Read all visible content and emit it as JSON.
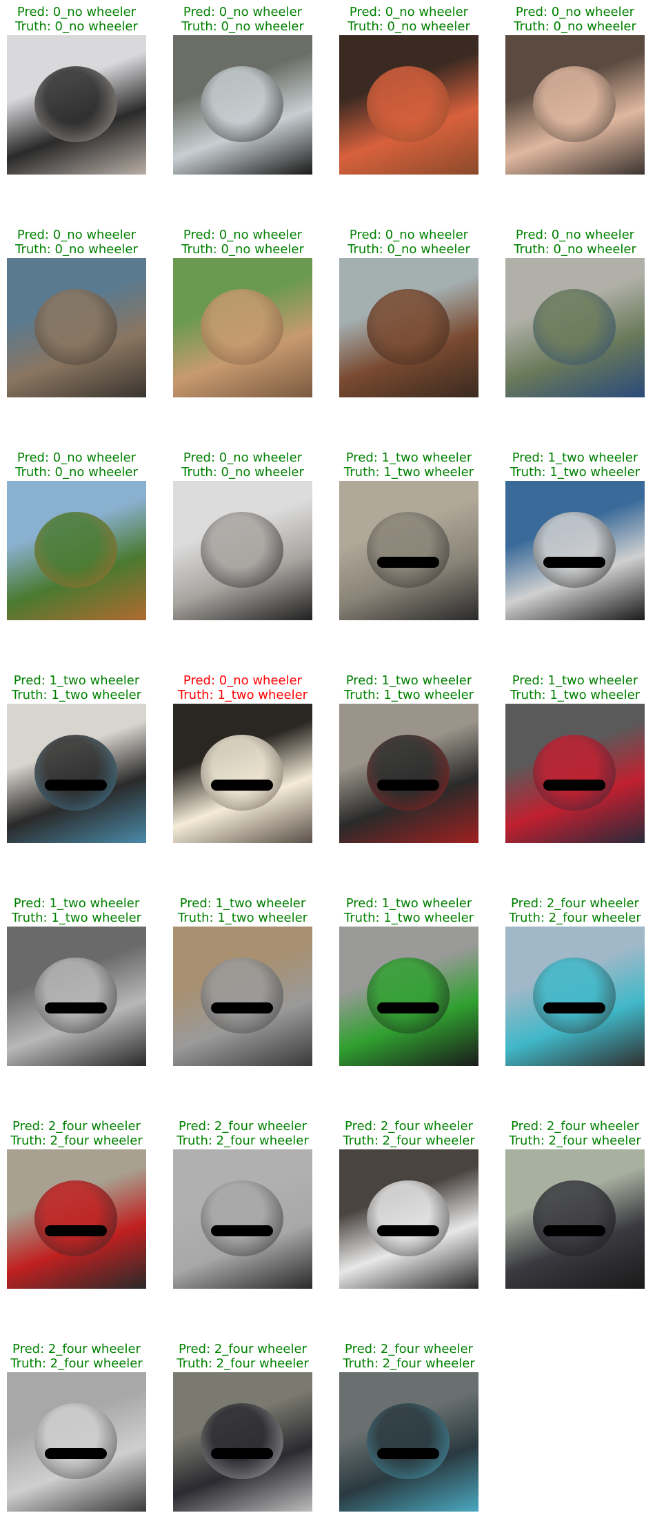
{
  "colors": {
    "correct": "#008000",
    "incorrect": "#ff0000"
  },
  "pred_prefix": "Pred: ",
  "truth_prefix": "Truth: ",
  "samples": [
    {
      "pred": "0_no wheeler",
      "truth": "0_no wheeler",
      "correct": true,
      "image": "cat-in-sink",
      "palette": [
        "#d9d9dc",
        "#2a2a2a",
        "#b8aea6"
      ]
    },
    {
      "pred": "0_no wheeler",
      "truth": "0_no wheeler",
      "correct": true,
      "image": "glass-bottle",
      "palette": [
        "#6a6e66",
        "#c8cfd2",
        "#1a1a1a"
      ]
    },
    {
      "pred": "0_no wheeler",
      "truth": "0_no wheeler",
      "correct": true,
      "image": "orange-armchair",
      "palette": [
        "#3b2a22",
        "#d8613d",
        "#8b4a2a"
      ]
    },
    {
      "pred": "0_no wheeler",
      "truth": "0_no wheeler",
      "correct": true,
      "image": "baby-with-party-hat",
      "palette": [
        "#5a4a40",
        "#e0b8a0",
        "#3c3430"
      ]
    },
    {
      "pred": "0_no wheeler",
      "truth": "0_no wheeler",
      "correct": true,
      "image": "monkey-thinking",
      "palette": [
        "#5a7a90",
        "#8a7560",
        "#3a3530"
      ]
    },
    {
      "pred": "0_no wheeler",
      "truth": "0_no wheeler",
      "correct": true,
      "image": "cartoon-monkey",
      "palette": [
        "#6a9a50",
        "#c89a70",
        "#7a5a40"
      ]
    },
    {
      "pred": "0_no wheeler",
      "truth": "0_no wheeler",
      "correct": true,
      "image": "caveman-figure",
      "palette": [
        "#a4afb0",
        "#7a4a30",
        "#3a2a20"
      ]
    },
    {
      "pred": "0_no wheeler",
      "truth": "0_no wheeler",
      "correct": true,
      "image": "boy-in-striped-shirt",
      "palette": [
        "#b0b0a8",
        "#6a7a5a",
        "#2a4a7a"
      ]
    },
    {
      "pred": "0_no wheeler",
      "truth": "0_no wheeler",
      "correct": true,
      "image": "cow-in-field",
      "palette": [
        "#8ab0d0",
        "#4a7a30",
        "#b06a30"
      ]
    },
    {
      "pred": "0_no wheeler",
      "truth": "0_no wheeler",
      "correct": true,
      "image": "hamster-face",
      "palette": [
        "#dcdcdc",
        "#a8a4a0",
        "#202020"
      ]
    },
    {
      "pred": "1_two wheeler",
      "truth": "1_two wheeler",
      "correct": true,
      "image": "motorcycle-on-road",
      "palette": [
        "#b0a898",
        "#8a8478",
        "#2a2a2a"
      ]
    },
    {
      "pred": "1_two wheeler",
      "truth": "1_two wheeler",
      "correct": true,
      "image": "motorcycle-front",
      "palette": [
        "#3a6a9a",
        "#d0d0d0",
        "#1a1a1a"
      ]
    },
    {
      "pred": "1_two wheeler",
      "truth": "1_two wheeler",
      "correct": true,
      "image": "electric-scooter",
      "palette": [
        "#d8d4ce",
        "#2a2a2a",
        "#4a8aa8"
      ]
    },
    {
      "pred": "0_no wheeler",
      "truth": "1_two wheeler",
      "correct": false,
      "image": "scooter-headlight",
      "palette": [
        "#2a2622",
        "#f4ecd8",
        "#5a5048"
      ]
    },
    {
      "pred": "1_two wheeler",
      "truth": "1_two wheeler",
      "correct": true,
      "image": "motorcycle-closeup",
      "palette": [
        "#9a948a",
        "#2a2a2a",
        "#a02020"
      ]
    },
    {
      "pred": "1_two wheeler",
      "truth": "1_two wheeler",
      "correct": true,
      "image": "red-scooter-people",
      "palette": [
        "#5a5a5a",
        "#c02030",
        "#2a2a3a"
      ]
    },
    {
      "pred": "1_two wheeler",
      "truth": "1_two wheeler",
      "correct": true,
      "image": "grey-scooter",
      "palette": [
        "#6a6a6a",
        "#b8b8b8",
        "#2a2a2a"
      ]
    },
    {
      "pred": "1_two wheeler",
      "truth": "1_two wheeler",
      "correct": true,
      "image": "silver-scooter",
      "palette": [
        "#a89070",
        "#9a9a9a",
        "#3a3a3a"
      ]
    },
    {
      "pred": "1_two wheeler",
      "truth": "1_two wheeler",
      "correct": true,
      "image": "green-sport-bike",
      "palette": [
        "#9a9a98",
        "#30a030",
        "#1a1a1a"
      ]
    },
    {
      "pred": "2_four wheeler",
      "truth": "2_four wheeler",
      "correct": true,
      "image": "blue-van",
      "palette": [
        "#a0b8c8",
        "#40b8c8",
        "#303030"
      ]
    },
    {
      "pred": "2_four wheeler",
      "truth": "2_four wheeler",
      "correct": true,
      "image": "red-suv",
      "palette": [
        "#a8a090",
        "#c02020",
        "#2a2a2a"
      ]
    },
    {
      "pred": "2_four wheeler",
      "truth": "2_four wheeler",
      "correct": true,
      "image": "silver-hatchback",
      "palette": [
        "#b0b0b0",
        "#a8a8a8",
        "#2a2a2a"
      ]
    },
    {
      "pred": "2_four wheeler",
      "truth": "2_four wheeler",
      "correct": true,
      "image": "white-suv",
      "palette": [
        "#4a4440",
        "#e8e8e8",
        "#2a2a2a"
      ]
    },
    {
      "pred": "2_four wheeler",
      "truth": "2_four wheeler",
      "correct": true,
      "image": "dark-grey-hatchback",
      "palette": [
        "#a8b0a0",
        "#3a3a40",
        "#1a1a1a"
      ]
    },
    {
      "pred": "2_four wheeler",
      "truth": "2_four wheeler",
      "correct": true,
      "image": "silver-car-front",
      "palette": [
        "#a8a8a8",
        "#cfcfcf",
        "#3a3a3a"
      ]
    },
    {
      "pred": "2_four wheeler",
      "truth": "2_four wheeler",
      "correct": true,
      "image": "black-compact-suv",
      "palette": [
        "#7a7a70",
        "#2a2a30",
        "#bcbcbc"
      ]
    },
    {
      "pred": "2_four wheeler",
      "truth": "2_four wheeler",
      "correct": true,
      "image": "blue-suv-front",
      "palette": [
        "#6a7070",
        "#2a3a40",
        "#4aa8c0"
      ]
    }
  ]
}
